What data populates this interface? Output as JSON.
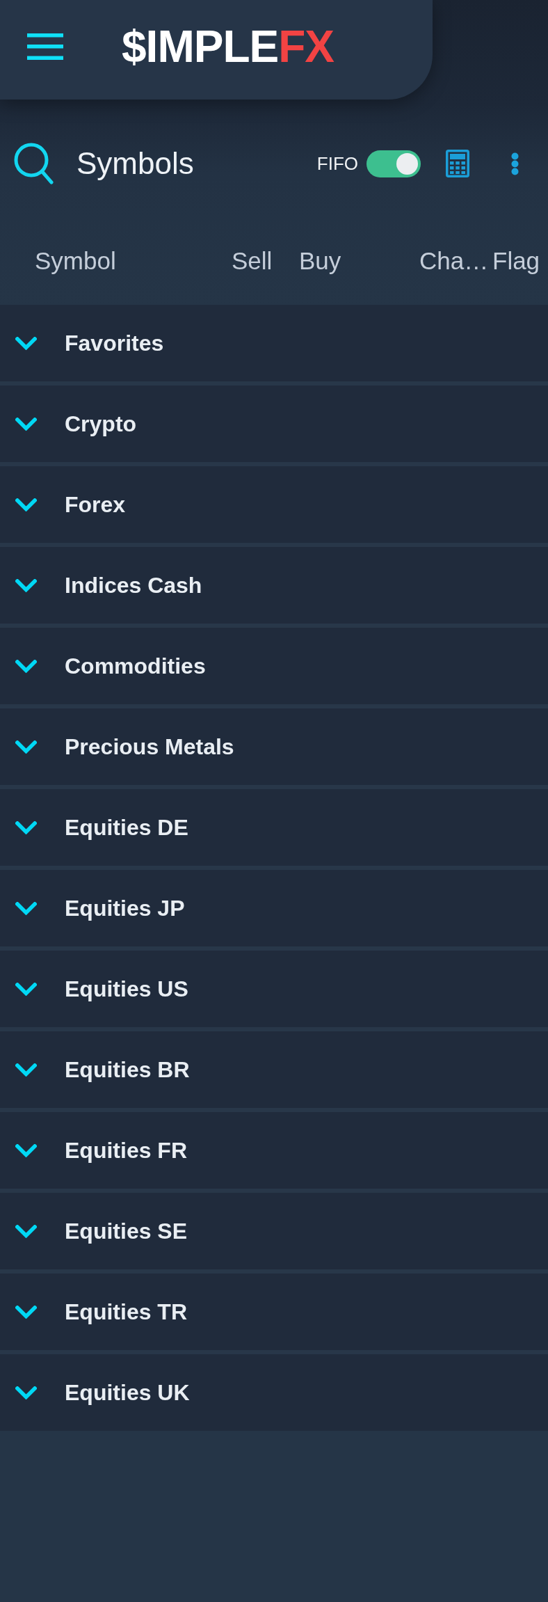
{
  "header": {
    "logo": {
      "text": "$IMPLE",
      "accent": "FX"
    }
  },
  "toolbar": {
    "title": "Symbols",
    "fifo": {
      "label": "FIFO",
      "on": true
    }
  },
  "table": {
    "columns": [
      "Symbol",
      "Sell",
      "Buy",
      "Cha…",
      "Flag"
    ],
    "groups": [
      {
        "name": "Favorites",
        "expanded": false
      },
      {
        "name": "Crypto",
        "expanded": false
      },
      {
        "name": "Forex",
        "expanded": false
      },
      {
        "name": "Indices Cash",
        "expanded": false
      },
      {
        "name": "Commodities",
        "expanded": false
      },
      {
        "name": "Precious Metals",
        "expanded": false
      },
      {
        "name": "Equities DE",
        "expanded": false
      },
      {
        "name": "Equities JP",
        "expanded": false
      },
      {
        "name": "Equities US",
        "expanded": false
      },
      {
        "name": "Equities BR",
        "expanded": false
      },
      {
        "name": "Equities FR",
        "expanded": false
      },
      {
        "name": "Equities SE",
        "expanded": false
      },
      {
        "name": "Equities TR",
        "expanded": false
      },
      {
        "name": "Equities UK",
        "expanded": false
      }
    ]
  }
}
